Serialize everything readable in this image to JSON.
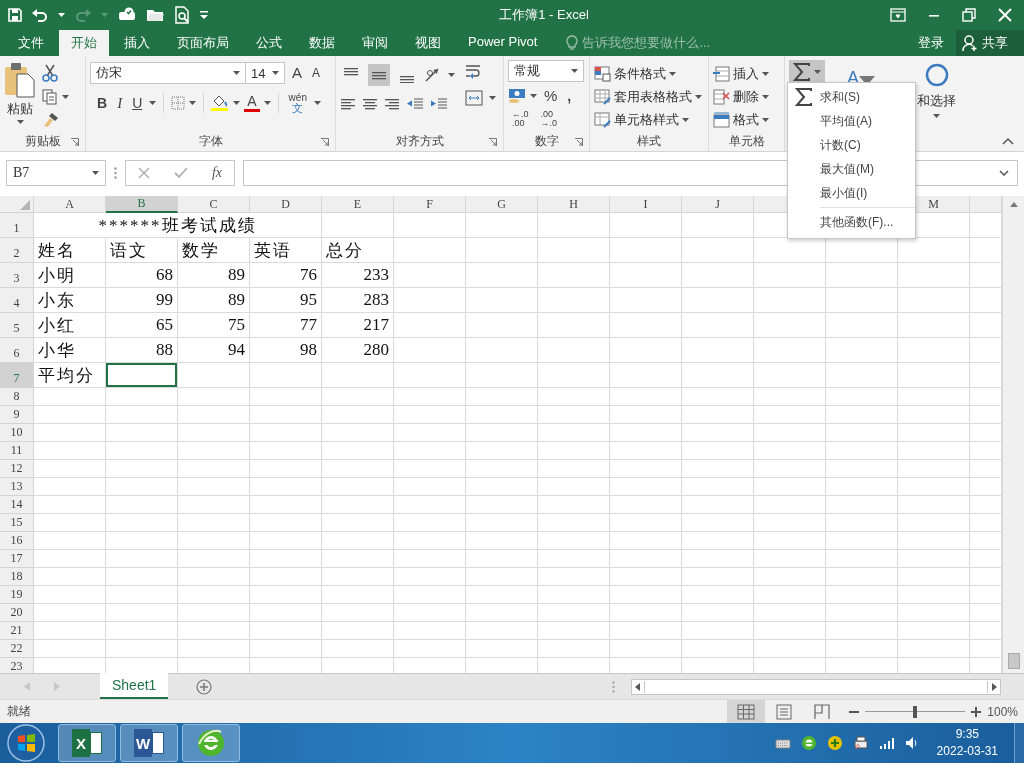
{
  "window": {
    "title": "工作簿1 - Excel"
  },
  "ribbon_tabs": [
    {
      "label": "文件",
      "selected": false
    },
    {
      "label": "开始",
      "selected": true
    },
    {
      "label": "插入",
      "selected": false
    },
    {
      "label": "页面布局",
      "selected": false
    },
    {
      "label": "公式",
      "selected": false
    },
    {
      "label": "数据",
      "selected": false
    },
    {
      "label": "审阅",
      "selected": false
    },
    {
      "label": "视图",
      "selected": false
    },
    {
      "label": "Power Pivot",
      "selected": false
    }
  ],
  "tell_me": {
    "placeholder": "告诉我您想要做什么..."
  },
  "account": {
    "sign_in": "登录",
    "share": "共享"
  },
  "ribbon": {
    "clipboard": {
      "label": "剪贴板",
      "paste": "粘贴"
    },
    "font": {
      "label": "字体",
      "font_name": "仿宋",
      "font_size": "14",
      "grow": "A",
      "shrink": "A",
      "bold": "B",
      "italic": "I",
      "underline": "U",
      "font_color": "A",
      "phonetic": [
        "wén",
        "文"
      ]
    },
    "alignment": {
      "label": "对齐方式",
      "vertical": [
        {
          "kind": "top",
          "selected": false
        },
        {
          "kind": "middle",
          "selected": true
        },
        {
          "kind": "bottom",
          "selected": false
        }
      ]
    },
    "number": {
      "label": "数字",
      "format": "常规",
      "percent": "%",
      "comma": ",",
      "increase_decimal": [
        "←.0",
        ".00"
      ],
      "decrease_decimal": [
        ".00",
        "→.0"
      ]
    },
    "styles": {
      "label": "样式",
      "items": [
        "条件格式",
        "套用表格格式",
        "单元格样式"
      ]
    },
    "cells": {
      "label": "单元格",
      "items": [
        "插入",
        "删除",
        "格式"
      ]
    },
    "editing": {
      "autosum_open": true,
      "sort_filter": "A",
      "find_select": "和选择"
    }
  },
  "autosum_menu": {
    "items": [
      {
        "kind": "sum",
        "label": "求和(S)"
      },
      {
        "kind": "plain",
        "label": "平均值(A)"
      },
      {
        "kind": "plain",
        "label": "计数(C)"
      },
      {
        "kind": "plain",
        "label": "最大值(M)"
      },
      {
        "kind": "plain",
        "label": "最小值(I)"
      },
      {
        "kind": "separator"
      },
      {
        "kind": "plain",
        "label": "其他函数(F)..."
      }
    ]
  },
  "formula_bar": {
    "name_box": "B7",
    "function_label": "fx"
  },
  "sheet": {
    "columns_left": [
      {
        "label": "A",
        "selected": false
      },
      {
        "label": "B",
        "selected": true
      },
      {
        "label": "C",
        "selected": false
      },
      {
        "label": "D",
        "selected": false
      },
      {
        "label": "E",
        "selected": false
      },
      {
        "label": "F",
        "selected": false
      },
      {
        "label": "G",
        "selected": false
      },
      {
        "label": "H",
        "selected": false
      },
      {
        "label": "I",
        "selected": false
      },
      {
        "label": "J",
        "selected": false
      }
    ],
    "columns_right": [
      {
        "label": "M",
        "selected": false
      }
    ],
    "rows": [
      {
        "header": "1",
        "selected": false,
        "cells": [
          {
            "kind": "title",
            "text": "******班考试成绩",
            "selected": false
          }
        ]
      },
      {
        "header": "2",
        "selected": false,
        "cells": [
          {
            "kind": "text",
            "text": "姓名",
            "selected": false
          },
          {
            "kind": "text",
            "text": "语文",
            "selected": false
          },
          {
            "kind": "text",
            "text": "数学",
            "selected": false
          },
          {
            "kind": "text",
            "text": "英语",
            "selected": false
          },
          {
            "kind": "text",
            "text": "总分",
            "selected": false
          }
        ]
      },
      {
        "header": "3",
        "selected": false,
        "cells": [
          {
            "kind": "text",
            "text": "小明",
            "selected": false
          },
          {
            "kind": "number",
            "text": "68",
            "selected": false
          },
          {
            "kind": "number",
            "text": "89",
            "selected": false
          },
          {
            "kind": "number",
            "text": "76",
            "selected": false
          },
          {
            "kind": "number",
            "text": "233",
            "selected": false
          }
        ]
      },
      {
        "header": "4",
        "selected": false,
        "cells": [
          {
            "kind": "text",
            "text": "小东",
            "selected": false
          },
          {
            "kind": "number",
            "text": "99",
            "selected": false
          },
          {
            "kind": "number",
            "text": "89",
            "selected": false
          },
          {
            "kind": "number",
            "text": "95",
            "selected": false
          },
          {
            "kind": "number",
            "text": "283",
            "selected": false
          }
        ]
      },
      {
        "header": "5",
        "selected": false,
        "cells": [
          {
            "kind": "text",
            "text": "小红",
            "selected": false
          },
          {
            "kind": "number",
            "text": "65",
            "selected": false
          },
          {
            "kind": "number",
            "text": "75",
            "selected": false
          },
          {
            "kind": "number",
            "text": "77",
            "selected": false
          },
          {
            "kind": "number",
            "text": "217",
            "selected": false
          }
        ]
      },
      {
        "header": "6",
        "selected": false,
        "cells": [
          {
            "kind": "text",
            "text": "小华",
            "selected": false
          },
          {
            "kind": "number",
            "text": "88",
            "selected": false
          },
          {
            "kind": "number",
            "text": "94",
            "selected": false
          },
          {
            "kind": "number",
            "text": "98",
            "selected": false
          },
          {
            "kind": "number",
            "text": "280",
            "selected": false
          }
        ]
      },
      {
        "header": "7",
        "selected": true,
        "cells": [
          {
            "kind": "text",
            "text": "平均分",
            "selected": false
          },
          {
            "kind": "blank",
            "selected": true
          }
        ]
      },
      {
        "header": "8",
        "selected": false
      },
      {
        "header": "9",
        "selected": false
      },
      {
        "header": "10",
        "selected": false
      },
      {
        "header": "11",
        "selected": false
      },
      {
        "header": "12",
        "selected": false
      },
      {
        "header": "13",
        "selected": false
      },
      {
        "header": "14",
        "selected": false
      },
      {
        "header": "15",
        "selected": false
      },
      {
        "header": "16",
        "selected": false
      },
      {
        "header": "17",
        "selected": false
      },
      {
        "header": "18",
        "selected": false
      },
      {
        "header": "19",
        "selected": false
      },
      {
        "header": "20",
        "selected": false
      },
      {
        "header": "21",
        "selected": false
      },
      {
        "header": "22",
        "selected": false
      },
      {
        "header": "23",
        "selected": false
      }
    ]
  },
  "sheet_tabs": [
    {
      "label": "Sheet1",
      "selected": true
    }
  ],
  "status_bar": {
    "status": "就绪",
    "views": [
      {
        "kind": "normal",
        "selected": true
      },
      {
        "kind": "page_layout",
        "selected": false
      },
      {
        "kind": "page_break",
        "selected": false
      }
    ],
    "zoom": {
      "level": 0.5,
      "reading": "100%"
    }
  },
  "taskbar": {
    "apps": [
      {
        "kind": "spreadsheet",
        "badge": "X"
      },
      {
        "kind": "document",
        "badge": "W"
      },
      {
        "kind": "browser"
      }
    ],
    "time": "9:35",
    "date": "2022-03-31"
  }
}
